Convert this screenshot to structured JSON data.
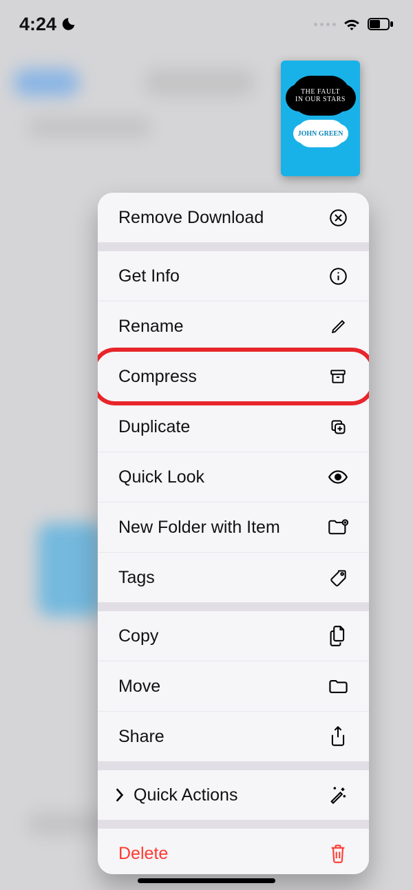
{
  "status_bar": {
    "time": "4:24",
    "dnd": true
  },
  "preview": {
    "title_line1": "THE FAULT",
    "title_line2": "IN OUR STARS",
    "author": "JOHN GREEN"
  },
  "menu": {
    "highlighted_index": 3,
    "items": [
      {
        "label": "Remove Download",
        "icon": "x-circle-icon",
        "sep_after": true
      },
      {
        "label": "Get Info",
        "icon": "info-circle-icon"
      },
      {
        "label": "Rename",
        "icon": "pencil-icon"
      },
      {
        "label": "Compress",
        "icon": "archive-box-icon"
      },
      {
        "label": "Duplicate",
        "icon": "duplicate-icon"
      },
      {
        "label": "Quick Look",
        "icon": "eye-icon"
      },
      {
        "label": "New Folder with Item",
        "icon": "folder-plus-icon"
      },
      {
        "label": "Tags",
        "icon": "tag-icon",
        "sep_after": true
      },
      {
        "label": "Copy",
        "icon": "doc-on-doc-icon"
      },
      {
        "label": "Move",
        "icon": "folder-icon"
      },
      {
        "label": "Share",
        "icon": "share-icon",
        "sep_after": true
      },
      {
        "label": "Quick Actions",
        "icon": "wand-icon",
        "chevron": true,
        "sep_after": true
      },
      {
        "label": "Delete",
        "icon": "trash-icon",
        "destructive": true
      }
    ]
  }
}
